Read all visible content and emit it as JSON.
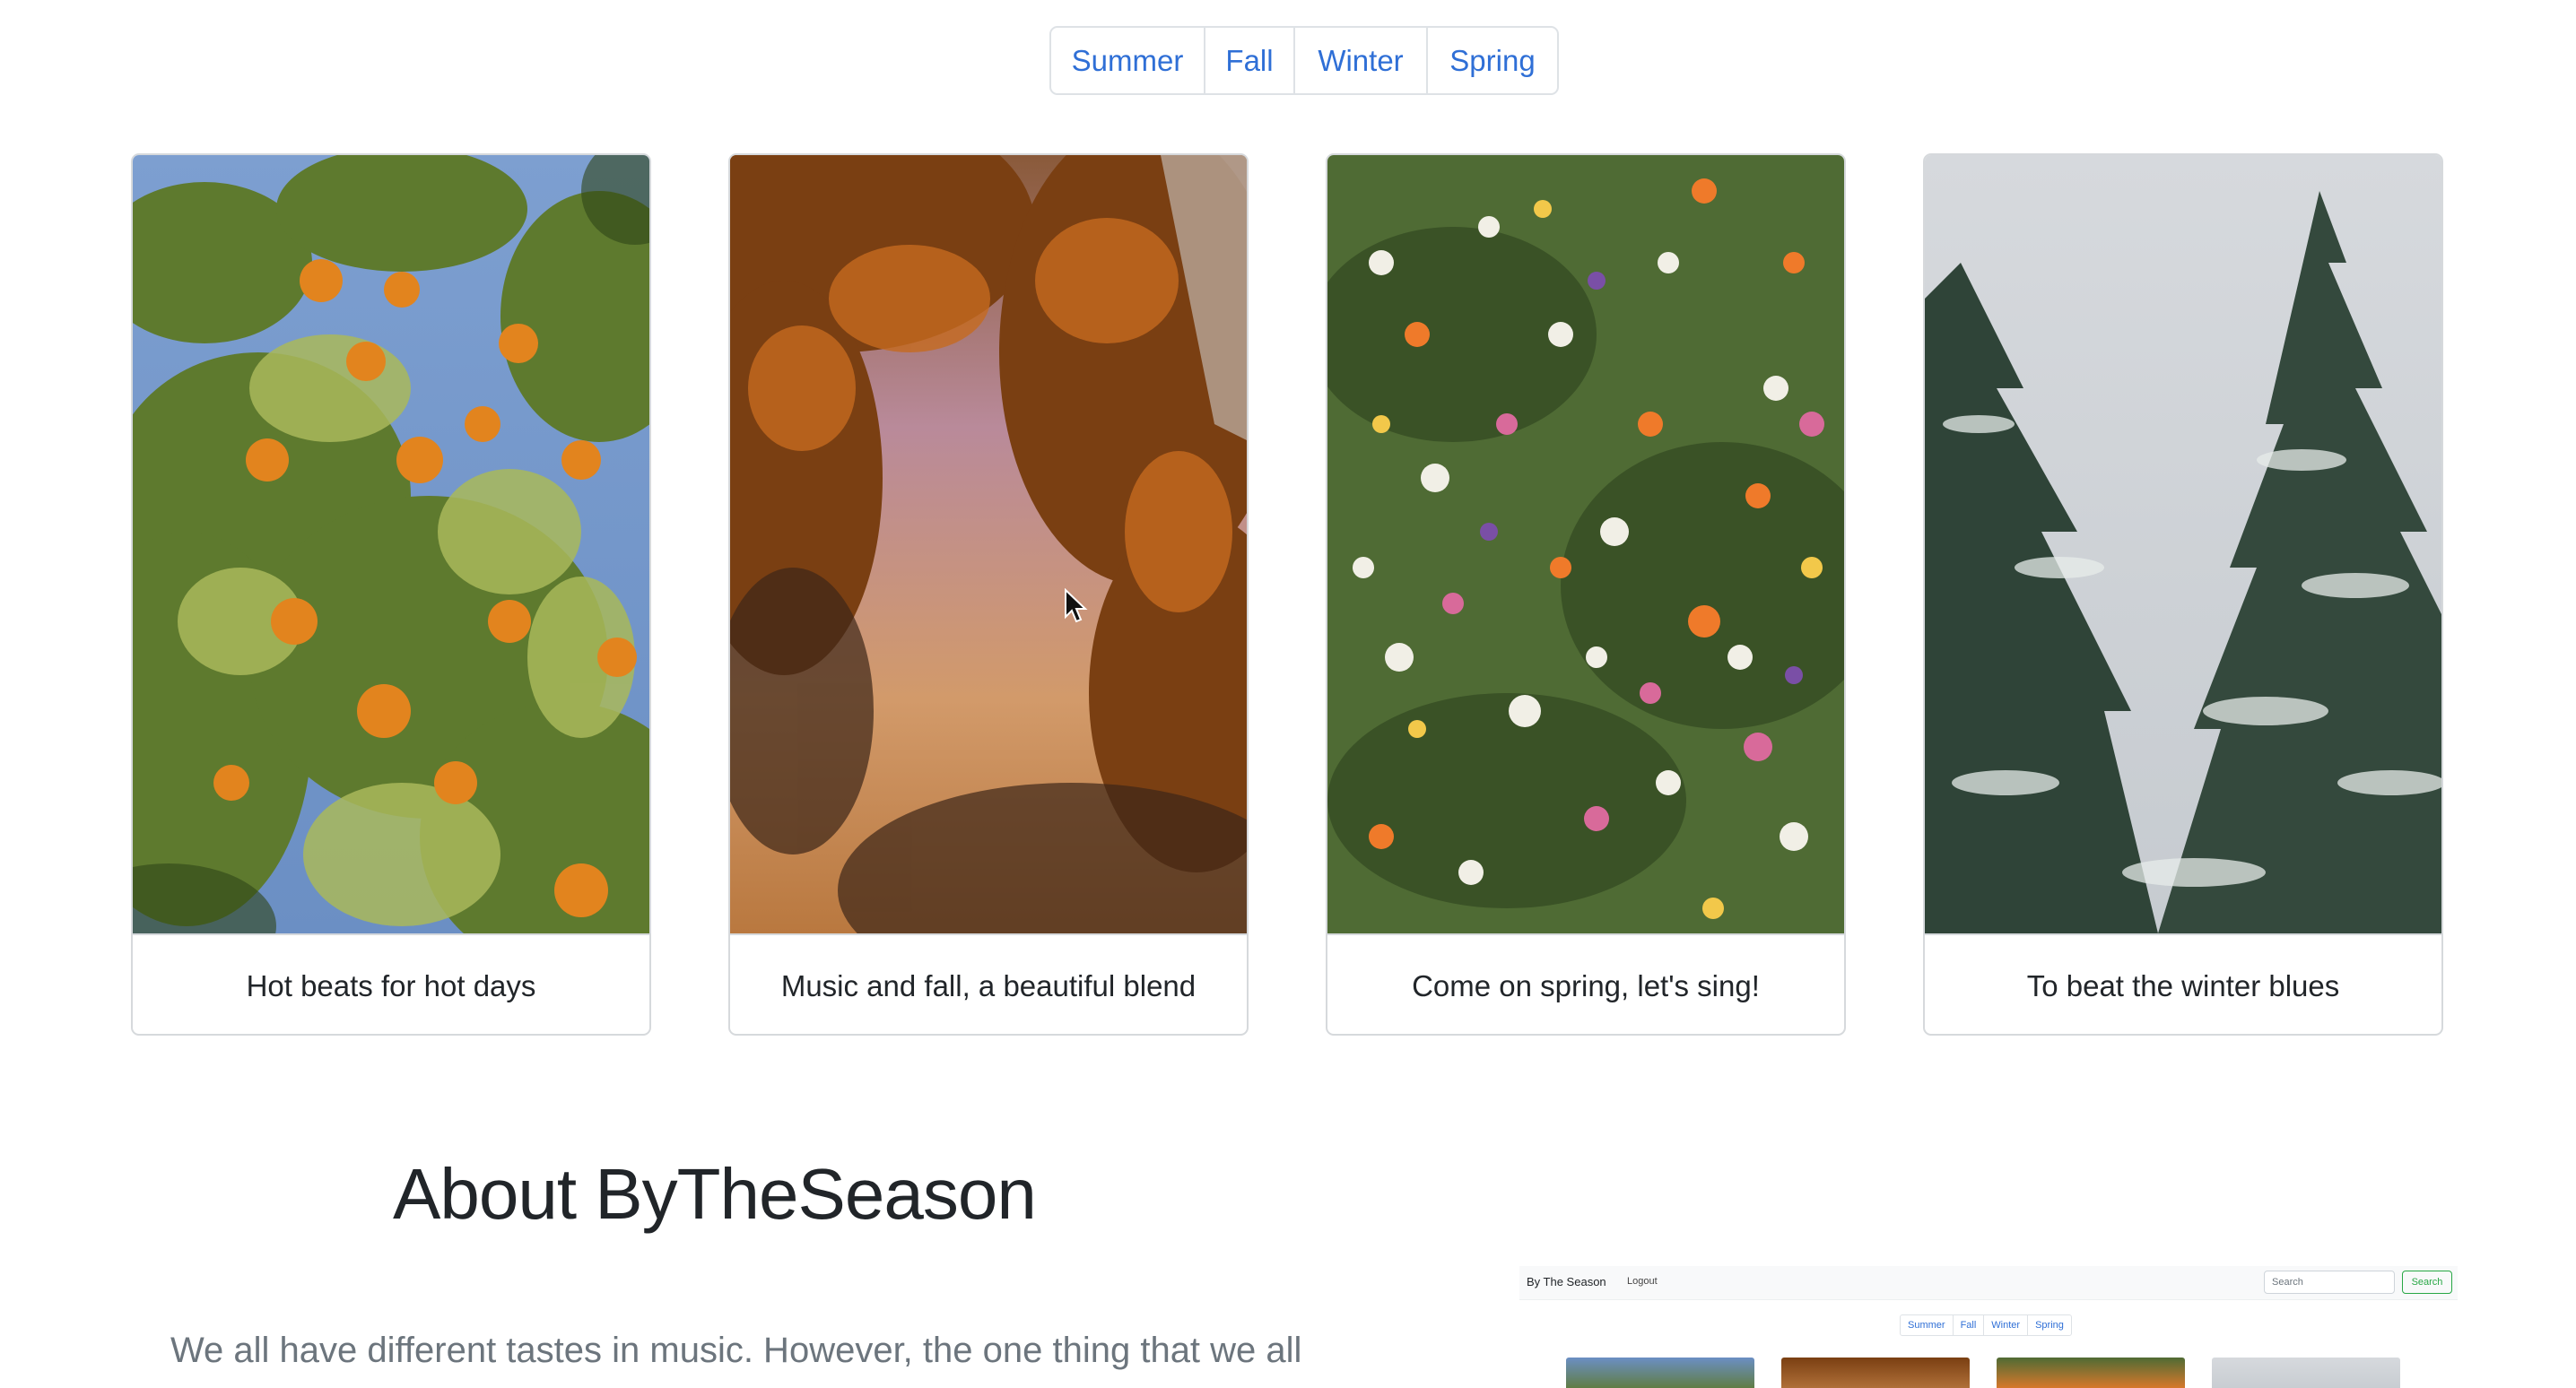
{
  "season_tabs": [
    "Summer",
    "Fall",
    "Winter",
    "Spring"
  ],
  "cards": [
    {
      "caption": "Hot beats for hot days",
      "image": "orange-tree-photo"
    },
    {
      "caption": "Music and fall, a beautiful blend",
      "image": "autumn-trees-sunset-photo"
    },
    {
      "caption": "Come on spring, let's sing!",
      "image": "wildflowers-photo"
    },
    {
      "caption": "To beat the winter blues",
      "image": "snowy-pine-trees-photo"
    }
  ],
  "about": {
    "title": "About ByTheSeason",
    "text": "We all have different tastes in music. However, the one thing that we all"
  },
  "preview": {
    "brand": "By The Season",
    "logout": "Logout",
    "search_placeholder": "Search",
    "search_button": "Search",
    "tabs": [
      "Summer",
      "Fall",
      "Winter",
      "Spring"
    ]
  },
  "colors": {
    "link": "#2f6fd6",
    "border": "#dee2e6",
    "muted_text": "#6c757d",
    "success": "#28a745"
  }
}
